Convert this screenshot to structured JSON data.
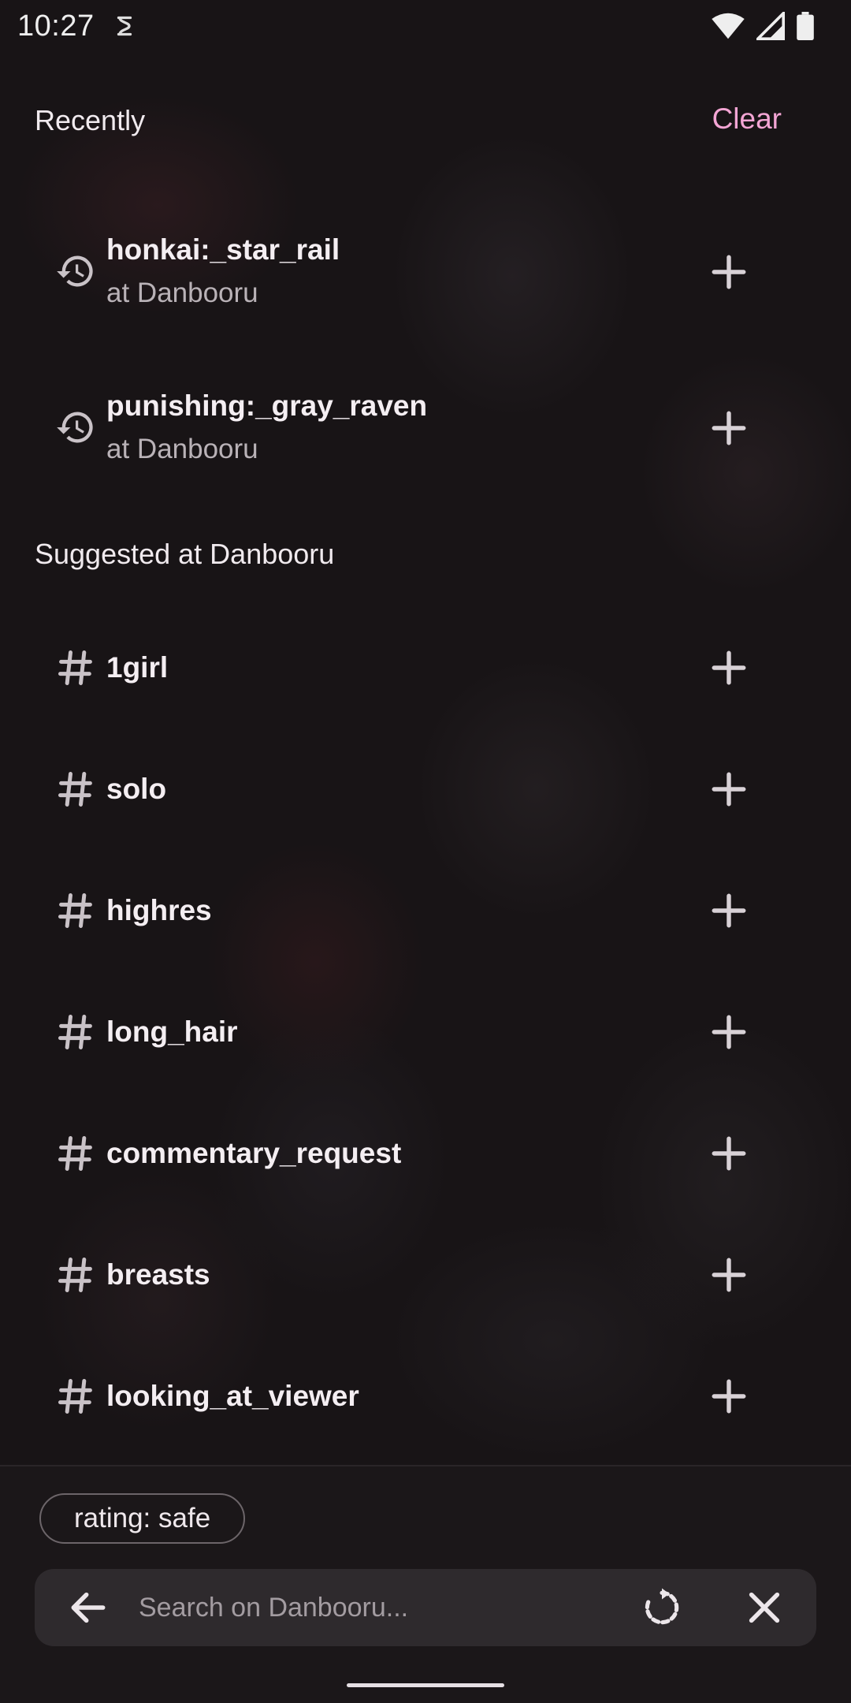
{
  "status_bar": {
    "time": "10:27",
    "icons": [
      "app-notification-icon",
      "wifi-icon",
      "signal-icon",
      "battery-icon"
    ]
  },
  "recent": {
    "header": "Recently",
    "clear_label": "Clear",
    "items": [
      {
        "tag": "honkai:_star_rail",
        "source": "at Danbooru",
        "icon": "history-icon"
      },
      {
        "tag": "punishing:_gray_raven",
        "source": "at Danbooru",
        "icon": "history-icon"
      }
    ]
  },
  "suggested": {
    "header": "Suggested at Danbooru",
    "items": [
      {
        "tag": "1girl",
        "icon": "hashtag-icon"
      },
      {
        "tag": "solo",
        "icon": "hashtag-icon"
      },
      {
        "tag": "highres",
        "icon": "hashtag-icon"
      },
      {
        "tag": "long_hair",
        "icon": "hashtag-icon"
      },
      {
        "tag": "commentary_request",
        "icon": "hashtag-icon"
      },
      {
        "tag": "breasts",
        "icon": "hashtag-icon"
      },
      {
        "tag": "looking_at_viewer",
        "icon": "hashtag-icon"
      }
    ]
  },
  "filter_chip": {
    "label": "rating: safe"
  },
  "search": {
    "value": "",
    "placeholder": "Search on Danbooru...",
    "icons": [
      "back-arrow-icon",
      "reset-icon",
      "close-icon"
    ]
  },
  "colors": {
    "background": "#181416",
    "accent": "#f3a5d4",
    "search_bar": "#2e2a2d"
  }
}
